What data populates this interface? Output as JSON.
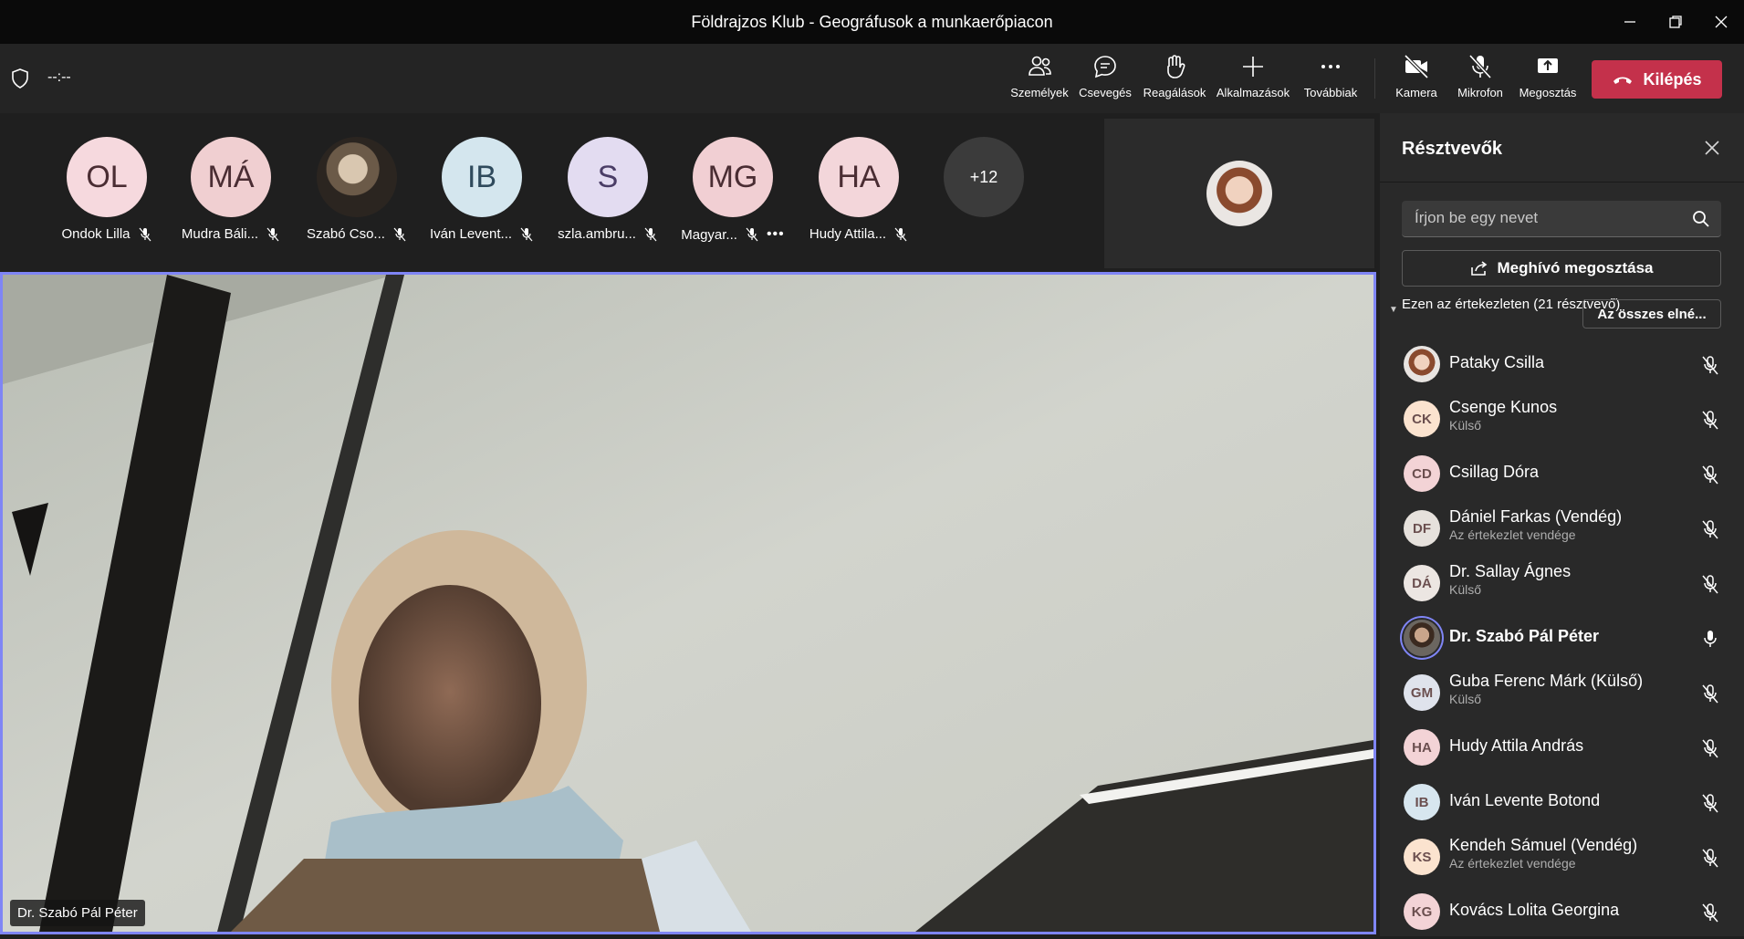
{
  "window": {
    "title": "Földrajzos Klub - Geográfusok a munkaerőpiacon",
    "controls": [
      "minimize-icon",
      "restore-icon",
      "close-icon"
    ]
  },
  "toolbar": {
    "timer": "--:--",
    "buttons": [
      {
        "label": "Személyek",
        "icon": "people-icon",
        "active": true
      },
      {
        "label": "Csevegés",
        "icon": "chat-icon"
      },
      {
        "label": "Reagálások",
        "icon": "raise-hand-icon"
      },
      {
        "label": "Alkalmazások",
        "icon": "plus-icon"
      },
      {
        "label": "Továbbiak",
        "icon": "more-icon"
      },
      {
        "label": "Kamera",
        "icon": "camera-off-icon"
      },
      {
        "label": "Mikrofon",
        "icon": "mic-off-icon"
      },
      {
        "label": "Megosztás",
        "icon": "share-icon"
      }
    ],
    "leave_label": "Kilépés"
  },
  "strip": {
    "participants": [
      {
        "initials": "OL",
        "name": "Ondok Lilla",
        "color": "#f6d9de"
      },
      {
        "initials": "MÁ",
        "name": "Mudra Báli...",
        "color": "#f0cfd1"
      },
      {
        "initials": "",
        "name": "Szabó Cso...",
        "color": "#3a3a3a",
        "photo": true
      },
      {
        "initials": "IB",
        "name": "Iván Levent...",
        "color": "#d4e6ee"
      },
      {
        "initials": "S",
        "name": "szla.ambru...",
        "color": "#e3dcf1"
      },
      {
        "initials": "MG",
        "name": "Magyar...",
        "color": "#f1cfd3"
      },
      {
        "initials": "HA",
        "name": "Hudy Attila...",
        "color": "#f3d6da"
      }
    ],
    "overflow": "+12"
  },
  "stage": {
    "speaker_label": "Dr. Szabó Pál Péter"
  },
  "panel": {
    "title": "Résztvevők",
    "search_placeholder": "Írjon be egy nevet",
    "invite_label": "Meghívó megosztása",
    "meeting_line": "Ezen az értekezleten (21 résztvevő)",
    "mute_all_label": "Az összes elné...",
    "people": [
      {
        "initials": "",
        "name": "Pataky Csilla",
        "sub": "",
        "photo": true,
        "color": "#d9b8a4",
        "mic": "off"
      },
      {
        "initials": "CK",
        "name": "Csenge Kunos",
        "sub": "Külső",
        "color": "#fbe3cf",
        "mic": "off"
      },
      {
        "initials": "CD",
        "name": "Csillag Dóra",
        "sub": "",
        "color": "#f3d3d6",
        "mic": "off"
      },
      {
        "initials": "DF",
        "name": "Dániel Farkas (Vendég)",
        "sub": "Az értekezlet vendége",
        "color": "#e6e1dc",
        "mic": "off"
      },
      {
        "initials": "DÁ",
        "name": "Dr. Sallay Ágnes",
        "sub": "Külső",
        "color": "#ece6e2",
        "mic": "off"
      },
      {
        "initials": "",
        "name": "Dr. Szabó Pál Péter",
        "sub": "",
        "photo": true,
        "speaking": true,
        "color": "#5a4a3c",
        "mic": "on"
      },
      {
        "initials": "GM",
        "name": "Guba Ferenc Márk (Külső)",
        "sub": "Külső",
        "color": "#dfe3ec",
        "mic": "off"
      },
      {
        "initials": "HA",
        "name": "Hudy Attila András",
        "sub": "",
        "color": "#f3d3d6",
        "mic": "off"
      },
      {
        "initials": "IB",
        "name": "Iván Levente Botond",
        "sub": "",
        "color": "#d7e6ef",
        "mic": "off"
      },
      {
        "initials": "KS",
        "name": "Kendeh Sámuel (Vendég)",
        "sub": "Az értekezlet vendége",
        "color": "#fbe3cf",
        "mic": "off"
      },
      {
        "initials": "KG",
        "name": "Kovács Lolita Georgina",
        "sub": "",
        "color": "#f3d3d6",
        "mic": "off"
      }
    ]
  }
}
